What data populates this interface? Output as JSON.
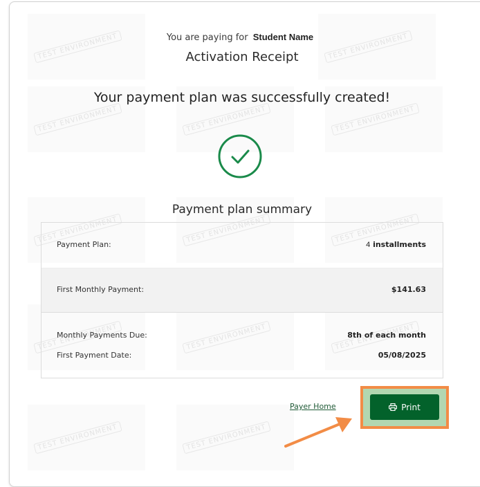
{
  "header": {
    "paying_prefix": "You are paying for",
    "student_name": "Student Name",
    "title": "Activation Receipt"
  },
  "success_message": "Your payment plan was successfully created!",
  "status_icon": "checkmark-circle-icon",
  "summary": {
    "title": "Payment plan summary",
    "rows": [
      {
        "label": "Payment Plan:",
        "value_num": "4",
        "value_text": " installments"
      },
      {
        "label": "First Monthly Payment:",
        "value": "$141.63"
      },
      {
        "label": "Monthly Payments Due:",
        "value": "8th of each month"
      },
      {
        "label": "First Payment Date:",
        "value": "05/08/2025"
      }
    ]
  },
  "actions": {
    "payer_home_label": "Payer Home",
    "print_label": "Print",
    "print_icon": "printer-icon"
  },
  "watermark": "TEST ENVIRONMENT",
  "colors": {
    "brand_green": "#03622b",
    "check_green": "#1a8a4a",
    "highlight_orange": "#f28c46"
  }
}
